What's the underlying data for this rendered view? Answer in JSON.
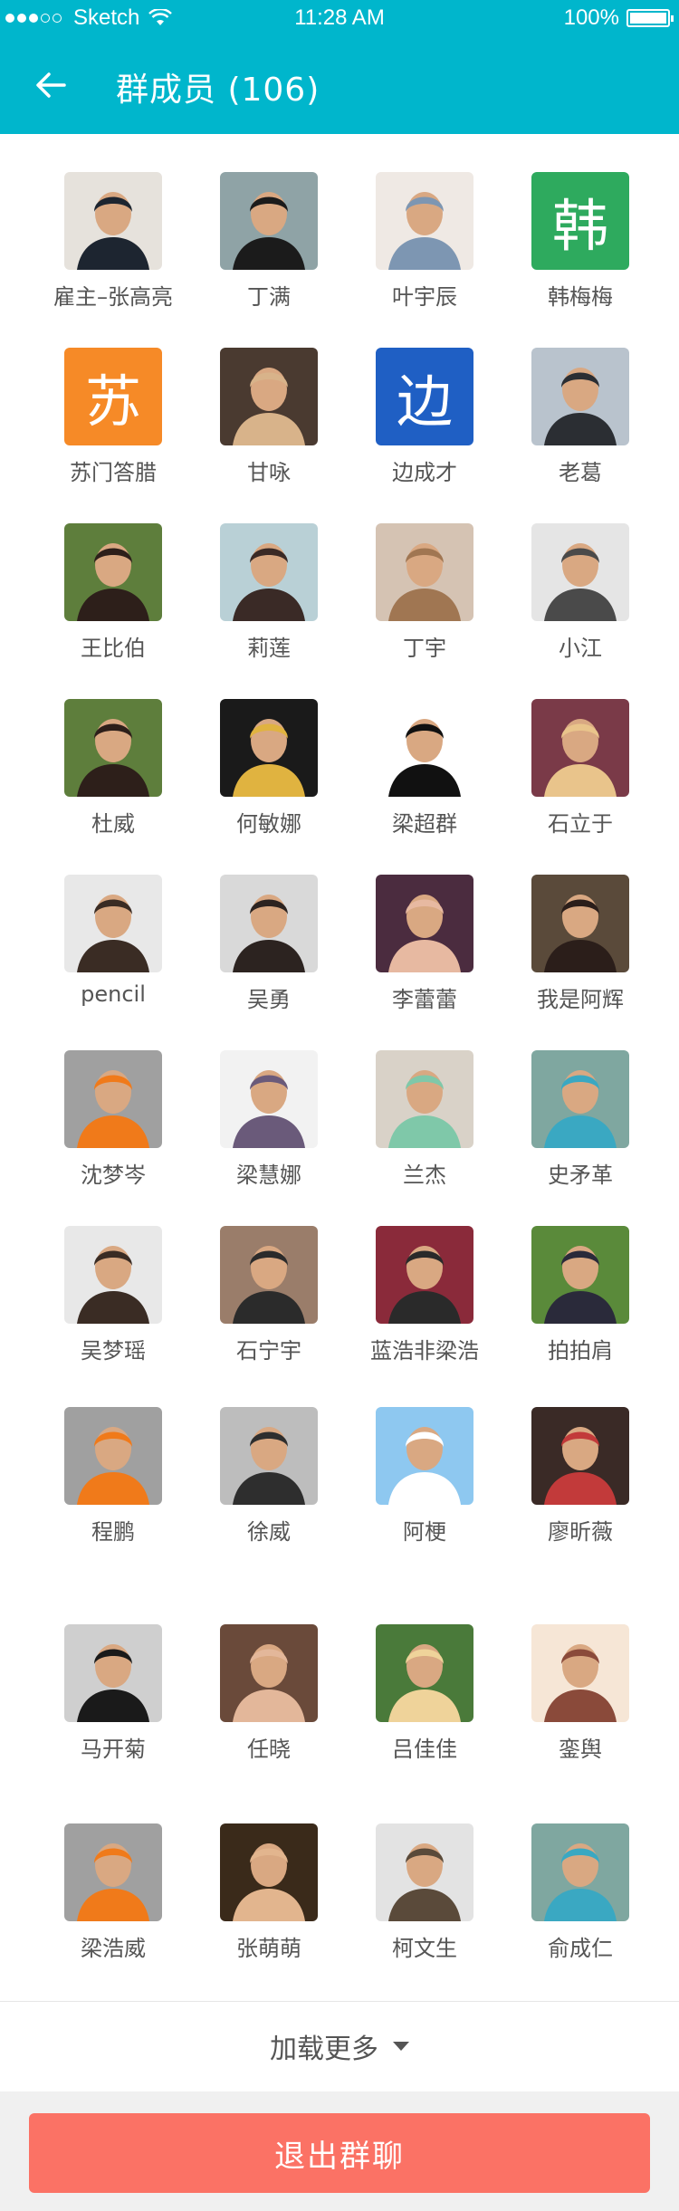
{
  "status_bar": {
    "carrier": "Sketch",
    "time": "11:28 AM",
    "battery": "100%",
    "signal_bars_filled": 3,
    "signal_bars_total": 5,
    "wifi_icon": "wifi-icon",
    "battery_icon": "battery-icon"
  },
  "nav": {
    "back_icon": "arrow-left-icon",
    "title": "群成员 (106)"
  },
  "members": [
    {
      "name": "雇主–张高亮",
      "avatar": {
        "type": "photo",
        "colors": [
          "#e6e2dc",
          "#1d2530"
        ]
      }
    },
    {
      "name": "丁满",
      "avatar": {
        "type": "photo",
        "colors": [
          "#8fa3a6",
          "#1b1b1b"
        ]
      }
    },
    {
      "name": "叶宇辰",
      "avatar": {
        "type": "photo",
        "colors": [
          "#efe9e4",
          "#7d96b2"
        ]
      }
    },
    {
      "name": "韩梅梅",
      "avatar": {
        "type": "text",
        "char": "韩",
        "color": "#2eaa5e"
      }
    },
    {
      "name": "苏门答腊",
      "avatar": {
        "type": "text",
        "char": "苏",
        "color": "#f68a27"
      }
    },
    {
      "name": "甘咏",
      "avatar": {
        "type": "photo",
        "colors": [
          "#4a3a30",
          "#d8b38a"
        ]
      }
    },
    {
      "name": "边成才",
      "avatar": {
        "type": "text",
        "char": "边",
        "color": "#1f5fc4"
      }
    },
    {
      "name": "老葛",
      "avatar": {
        "type": "photo",
        "colors": [
          "#b9c3cd",
          "#2b2e33"
        ]
      }
    },
    {
      "name": "王比伯",
      "avatar": {
        "type": "photo",
        "colors": [
          "#5e7e3c",
          "#2d1f1a"
        ]
      }
    },
    {
      "name": "莉莲",
      "avatar": {
        "type": "photo",
        "colors": [
          "#b9d0d6",
          "#3a2a26"
        ]
      }
    },
    {
      "name": "丁宇",
      "avatar": {
        "type": "photo",
        "colors": [
          "#d5c3b3",
          "#a07652"
        ]
      }
    },
    {
      "name": "小江",
      "avatar": {
        "type": "photo",
        "colors": [
          "#e5e5e5",
          "#4a4a4a"
        ]
      }
    },
    {
      "name": "杜威",
      "avatar": {
        "type": "photo",
        "colors": [
          "#5e7e3c",
          "#2d1f1a"
        ]
      }
    },
    {
      "name": "何敏娜",
      "avatar": {
        "type": "photo",
        "colors": [
          "#1a1a1a",
          "#e0b340"
        ]
      }
    },
    {
      "name": "梁超群",
      "avatar": {
        "type": "photo",
        "colors": [
          "#ffffff",
          "#111111"
        ]
      }
    },
    {
      "name": "石立于",
      "avatar": {
        "type": "photo",
        "colors": [
          "#7a3a48",
          "#e9c48b"
        ]
      }
    },
    {
      "name": "pencil",
      "avatar": {
        "type": "photo",
        "colors": [
          "#e8e8e8",
          "#3a2c24"
        ]
      }
    },
    {
      "name": "吴勇",
      "avatar": {
        "type": "photo",
        "colors": [
          "#d9d9d9",
          "#2c2320"
        ]
      }
    },
    {
      "name": "李蕾蕾",
      "avatar": {
        "type": "photo",
        "colors": [
          "#4b2c3f",
          "#e7b9a1"
        ]
      }
    },
    {
      "name": "我是阿辉",
      "avatar": {
        "type": "photo",
        "colors": [
          "#5a4a3a",
          "#2b1e1a"
        ]
      }
    },
    {
      "name": "沈梦岑",
      "avatar": {
        "type": "photo",
        "colors": [
          "#a0a0a0",
          "#f07a1a"
        ]
      }
    },
    {
      "name": "梁慧娜",
      "avatar": {
        "type": "photo",
        "colors": [
          "#f2f2f2",
          "#6a5a7a"
        ]
      }
    },
    {
      "name": "兰杰",
      "avatar": {
        "type": "photo",
        "colors": [
          "#d9d2c8",
          "#7fc8a9"
        ]
      }
    },
    {
      "name": "史矛革",
      "avatar": {
        "type": "photo",
        "colors": [
          "#7fa7a0",
          "#3aa8c2"
        ]
      }
    },
    {
      "name": "吴梦瑶",
      "avatar": {
        "type": "photo",
        "colors": [
          "#e8e8e8",
          "#3a2c24"
        ]
      }
    },
    {
      "name": "石宁宇",
      "avatar": {
        "type": "photo",
        "colors": [
          "#9a7d6a",
          "#2b2b2b"
        ]
      }
    },
    {
      "name": "蓝浩非梁浩",
      "avatar": {
        "type": "photo",
        "colors": [
          "#8a2a3a",
          "#2a2a2a"
        ]
      }
    },
    {
      "name": "拍拍肩",
      "avatar": {
        "type": "photo",
        "colors": [
          "#5a8a3a",
          "#2a2a3a"
        ]
      }
    },
    {
      "name": "程鹏",
      "avatar": {
        "type": "photo",
        "colors": [
          "#a0a0a0",
          "#f07a1a"
        ]
      }
    },
    {
      "name": "徐威",
      "avatar": {
        "type": "photo",
        "colors": [
          "#bdbdbd",
          "#2e2e2e"
        ]
      }
    },
    {
      "name": "阿梗",
      "avatar": {
        "type": "photo",
        "colors": [
          "#8ec8f0",
          "#ffffff"
        ]
      }
    },
    {
      "name": "廖昕薇",
      "avatar": {
        "type": "photo",
        "colors": [
          "#3a2a26",
          "#c23a3a"
        ]
      }
    },
    {
      "name": "马开菊",
      "avatar": {
        "type": "photo",
        "colors": [
          "#cfcfcf",
          "#1a1a1a"
        ]
      }
    },
    {
      "name": "任晓",
      "avatar": {
        "type": "photo",
        "colors": [
          "#6a4a3a",
          "#e3b79a"
        ]
      }
    },
    {
      "name": "吕佳佳",
      "avatar": {
        "type": "photo",
        "colors": [
          "#4a7a3a",
          "#efd39a"
        ]
      }
    },
    {
      "name": "銮舆",
      "avatar": {
        "type": "photo",
        "colors": [
          "#f6e6d6",
          "#8a4a3a"
        ]
      }
    },
    {
      "name": "梁浩威",
      "avatar": {
        "type": "photo",
        "colors": [
          "#a0a0a0",
          "#f07a1a"
        ]
      }
    },
    {
      "name": "张萌萌",
      "avatar": {
        "type": "photo",
        "colors": [
          "#3a2a1a",
          "#e2b58e"
        ]
      }
    },
    {
      "name": "柯文生",
      "avatar": {
        "type": "photo",
        "colors": [
          "#e3e3e3",
          "#5a4a3a"
        ]
      }
    },
    {
      "name": "俞成仁",
      "avatar": {
        "type": "photo",
        "colors": [
          "#7fa7a0",
          "#3aa8c2"
        ]
      }
    }
  ],
  "load_more": {
    "label": "加载更多",
    "icon": "caret-down-icon"
  },
  "footer": {
    "exit_label": "退出群聊",
    "exit_color": "#fb7265"
  },
  "theme": {
    "primary": "#00b6cc",
    "text_muted": "#555555"
  }
}
